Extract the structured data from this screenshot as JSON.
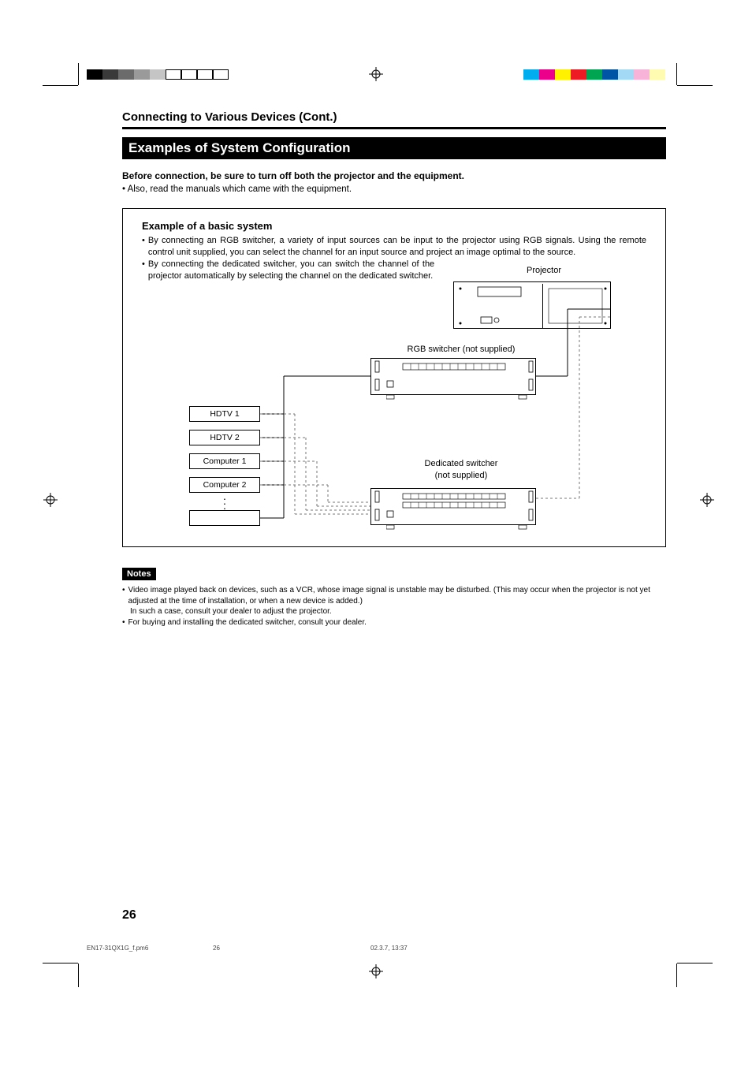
{
  "header": {
    "section_title": "Connecting to Various Devices (Cont.)",
    "subsection_bar": "Examples of System Configuration"
  },
  "intro": {
    "bold": "Before connection, be sure to turn off both the projector and the equipment.",
    "line": "• Also, read the manuals which came with the equipment."
  },
  "example": {
    "title": "Example of a basic system",
    "bullet1": "By connecting an RGB switcher, a variety of input sources can be input to the projector using RGB signals. Using the remote control unit supplied, you can select the channel for an input source and project an image optimal to the source.",
    "bullet2": "By connecting the dedicated switcher, you can switch the channel of the projector automatically by selecting the channel on the dedicated switcher.",
    "labels": {
      "projector": "Projector",
      "rgb_switcher": "RGB switcher (not supplied)",
      "dedicated_switcher_1": "Dedicated switcher",
      "dedicated_switcher_2": "(not supplied)"
    },
    "sources": [
      "HDTV 1",
      "HDTV 2",
      "Computer 1",
      "Computer 2",
      ""
    ]
  },
  "notes": {
    "badge": "Notes",
    "items": [
      "Video image played back on devices, such as a VCR, whose image signal is unstable may be disturbed. (This may occur when the projector is not yet adjusted at the time of installation, or when a new device is added.)",
      "For buying and installing the dedicated switcher, consult your dealer."
    ],
    "sub": "In such a case, consult your dealer to adjust the projector."
  },
  "page_number": "26",
  "footer": {
    "file": "EN17-31QX1G_f.pm6",
    "page": "26",
    "datetime": "02.3.7, 13:37"
  },
  "colors": {
    "left_bar": [
      "#000",
      "#3a3a3a",
      "#6b6b6b",
      "#9a9a9a",
      "#c5c5c5",
      "#fff",
      "#fff",
      "#fff",
      "#fff"
    ],
    "right_bar": [
      "#00adee",
      "#ec008b",
      "#fff100",
      "#ed1b24",
      "#00a551",
      "#0054a5",
      "#a4d9f6",
      "#f8b3d9",
      "#fffbb0"
    ]
  }
}
